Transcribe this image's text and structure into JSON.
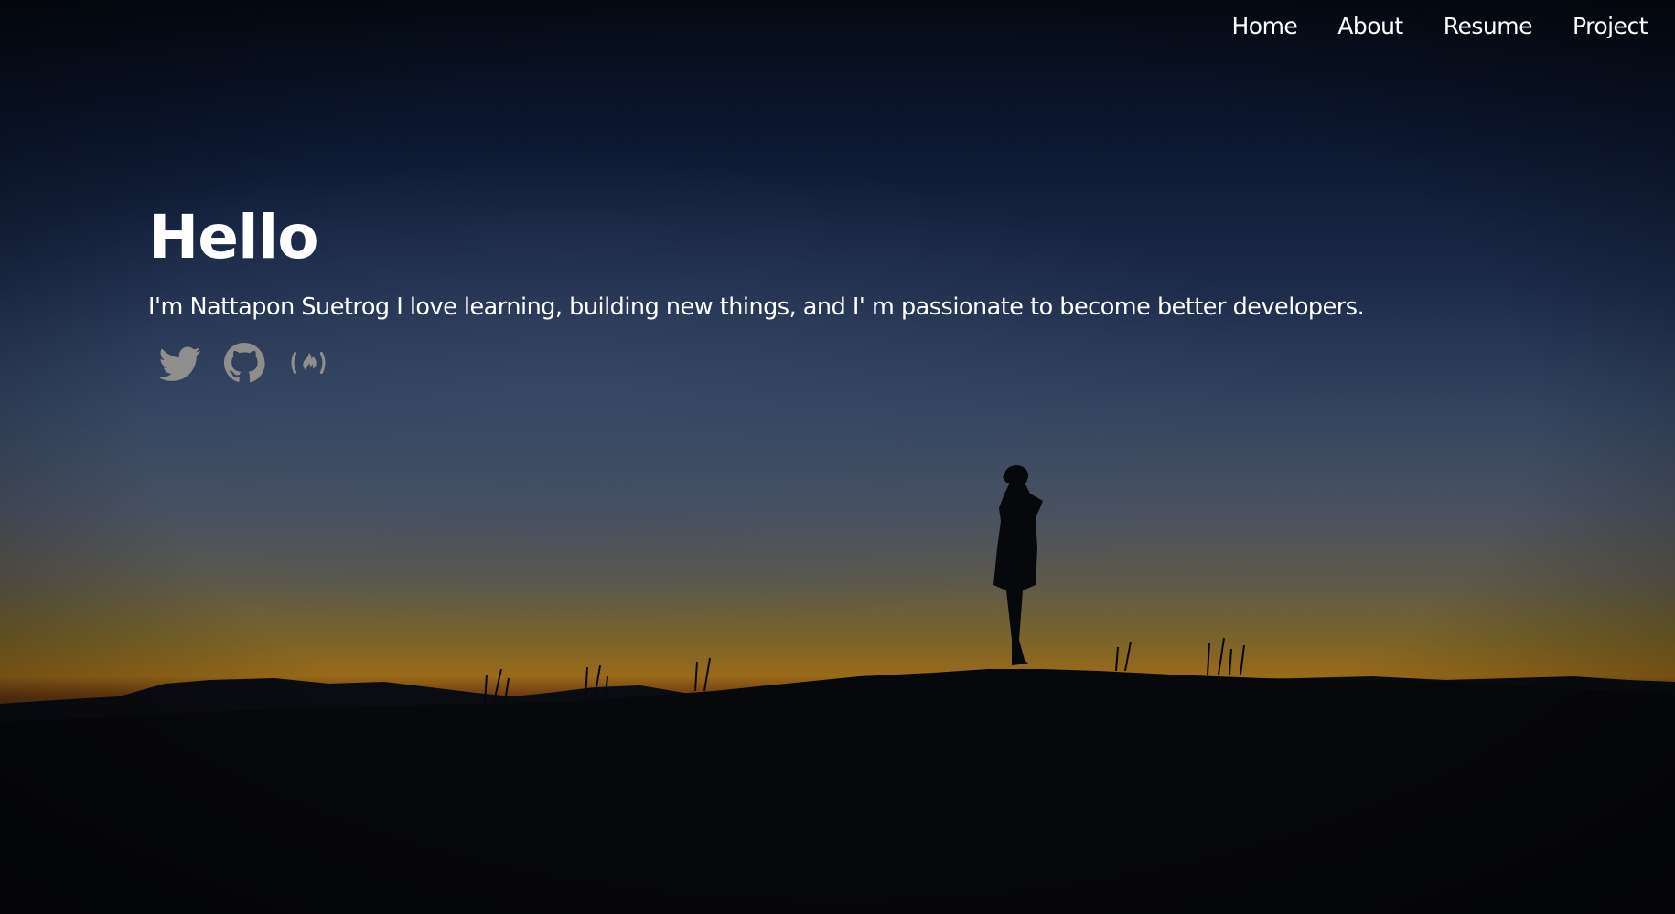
{
  "nav": {
    "items": [
      {
        "label": "Home"
      },
      {
        "label": "About"
      },
      {
        "label": "Resume"
      },
      {
        "label": "Project"
      }
    ]
  },
  "hero": {
    "heading": "Hello",
    "tagline": "I'm Nattapon Suetrog I love learning, building new things, and I' m passionate to become better developers.",
    "background": "night-sky-silhouette-landscape"
  },
  "socials": [
    {
      "icon": "twitter-icon"
    },
    {
      "icon": "github-icon"
    },
    {
      "icon": "freecodecamp-icon"
    }
  ],
  "colors": {
    "text": "#ffffff",
    "icon": "#8e8e8e",
    "sky_top": "#050b16",
    "sky_mid": "#2b3d5c",
    "horizon_glow": "#a66a18",
    "ground": "#06070b"
  }
}
